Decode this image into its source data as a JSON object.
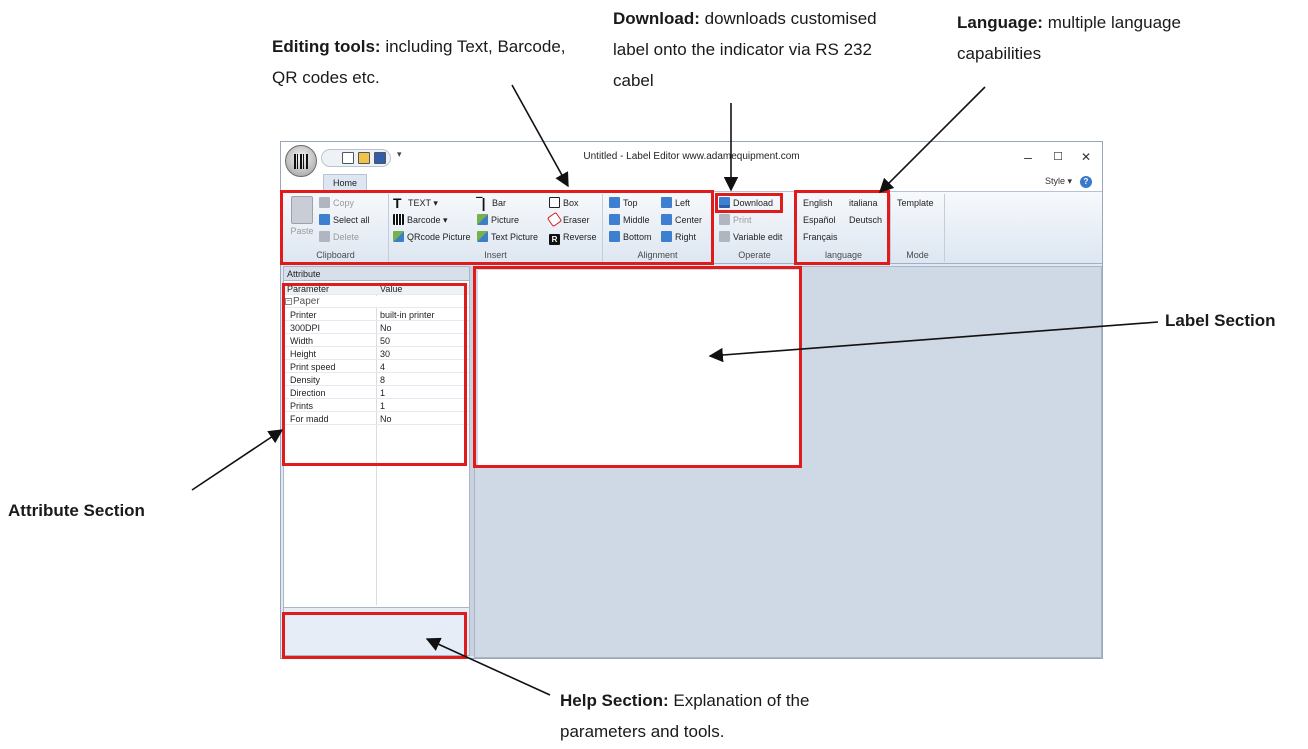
{
  "callouts": {
    "editing": {
      "title": "Editing tools:",
      "text": "including Text, Barcode, QR codes etc."
    },
    "download": {
      "title": "Download:",
      "text": "downloads customised label onto the indicator via RS 232 cabel"
    },
    "language": {
      "title": "Language:",
      "text": "multiple language capabilities"
    },
    "label_section": {
      "title": "Label Section"
    },
    "attribute_section": {
      "title": "Attribute Section"
    },
    "help_section": {
      "title": "Help Section:",
      "text": "Explanation of the parameters and tools."
    }
  },
  "window": {
    "title": "Untitled - Label Editor www.adamequipment.com",
    "controls": {
      "minimize": "–",
      "maximize": "☐",
      "close": "✕"
    },
    "qat_more": "▾"
  },
  "tabs": {
    "home": "Home",
    "style": "Style",
    "style_caret": "▾",
    "help": "?"
  },
  "ribbon": {
    "clipboard": {
      "label": "Clipboard",
      "paste": "Paste",
      "copy": "Copy",
      "select_all": "Select all",
      "delete": "Delete"
    },
    "insert": {
      "label": "Insert",
      "text": "TEXT",
      "text_caret": "▾",
      "barcode": "Barcode",
      "barcode_caret": "▾",
      "qrcode_picture": "QRcode Picture",
      "bar": "Bar",
      "picture": "Picture",
      "text_picture": "Text Picture",
      "box": "Box",
      "eraser": "Eraser",
      "reverse": "Reverse"
    },
    "alignment": {
      "label": "Alignment",
      "top": "Top",
      "middle": "Middle",
      "bottom": "Bottom",
      "left": "Left",
      "center": "Center",
      "right": "Right"
    },
    "operate": {
      "label": "Operate",
      "download": "Download",
      "print": "Print",
      "variable_edit": "Variable edit"
    },
    "language": {
      "label": "language",
      "english": "English",
      "italiana": "italiana",
      "espanol": "Español",
      "deutsch": "Deutsch",
      "francais": "Français"
    },
    "mode": {
      "label": "Mode",
      "template": "Template"
    }
  },
  "attribute": {
    "title": "Attribute",
    "columns": [
      "Parameter",
      "Value"
    ],
    "category": "Paper",
    "expander": "−",
    "rows": [
      {
        "name": "Printer",
        "value": "built-in printer"
      },
      {
        "name": "300DPI",
        "value": "No"
      },
      {
        "name": "Width",
        "value": "50"
      },
      {
        "name": "Height",
        "value": "30"
      },
      {
        "name": "Print speed",
        "value": "4"
      },
      {
        "name": "Density",
        "value": "8"
      },
      {
        "name": "Direction",
        "value": "1"
      },
      {
        "name": "Prints",
        "value": "1"
      },
      {
        "name": "For madd",
        "value": "No"
      }
    ]
  },
  "colors": {
    "highlight": "#e01b1b",
    "workspace": "#cfd8e5",
    "ribbon": "#dde6f1"
  }
}
